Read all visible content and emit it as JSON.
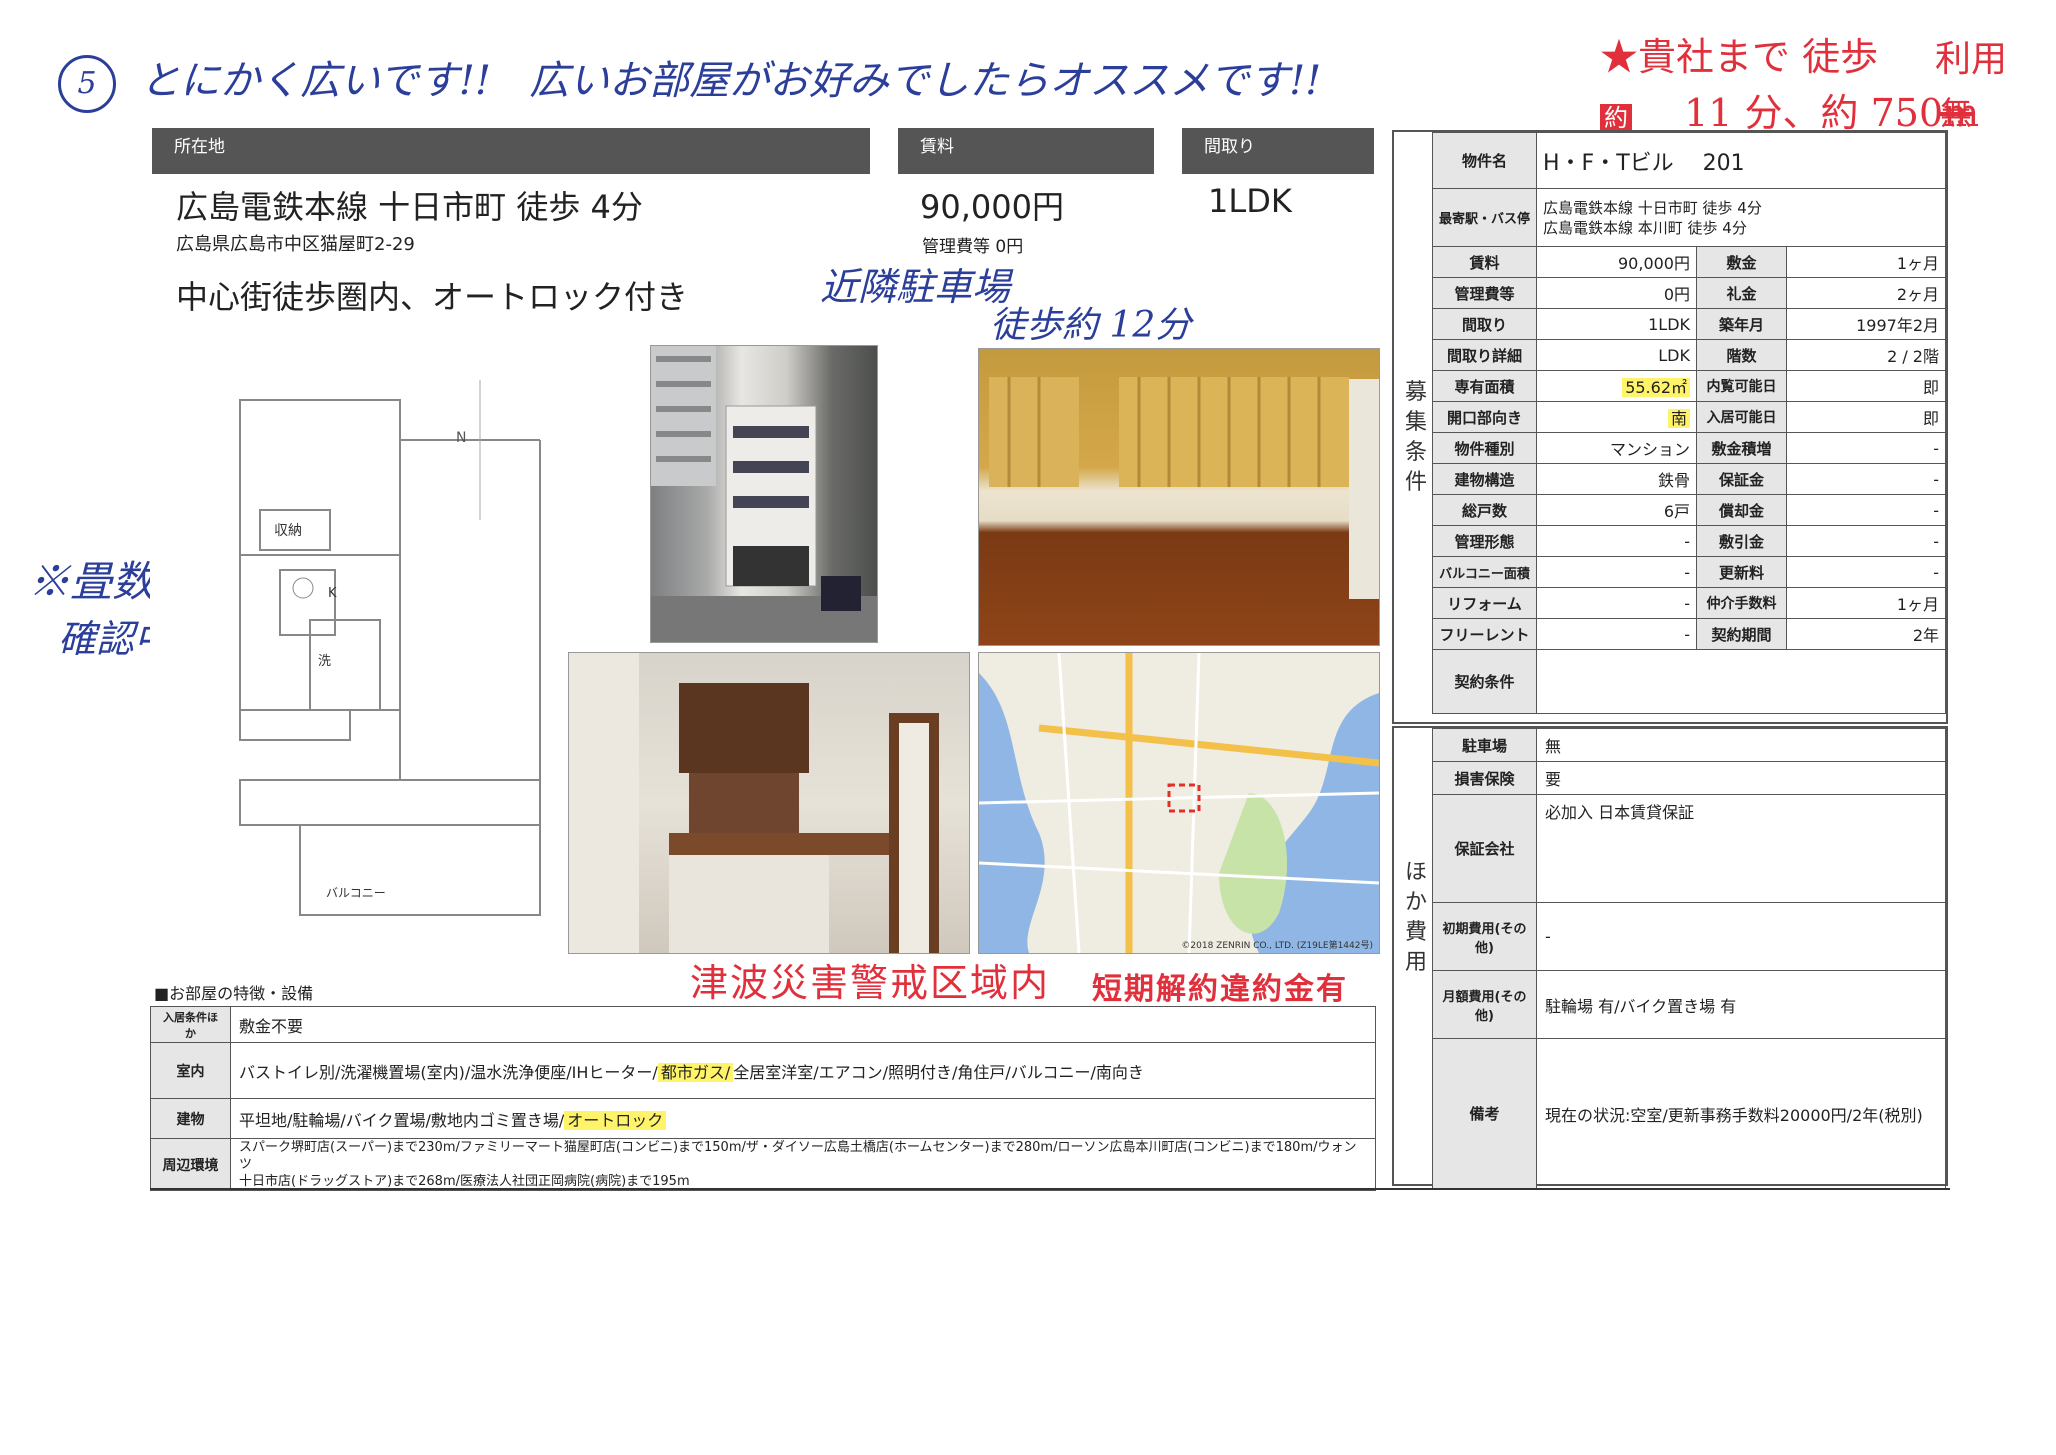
{
  "annotations": {
    "circle_number": "5",
    "top_comment": "とにかく広いです!!   広いお部屋がお好みでしたらオススメです!!",
    "red_line1_star": "★",
    "red_line1": "貴社まで 徒歩",
    "red_riyou": "利用",
    "red_line2_sym": "約",
    "red_line2": "11 分、約 750m",
    "red_crossed": "無",
    "parking_note1": "近隣駐車場",
    "parking_note2": "徒歩約 12分",
    "tatami_note1": "※畳数",
    "tatami_note2": "確認中です。",
    "tsunami_warning": "津波災害警戒区域内",
    "short_term_penalty": "短期解約違約金有"
  },
  "header": {
    "location_label": "所在地",
    "rent_label": "賃料",
    "layout_label": "間取り",
    "station": "広島電鉄本線 十日市町 徒歩 4分",
    "address": "広島県広島市中区猫屋町2-29",
    "rent": "90,000円",
    "mgmt_fee": "管理費等 0円",
    "layout": "1LDK",
    "catch_copy": "中心街徒歩圏内、オートロック付き"
  },
  "floorplan": {
    "north": "N",
    "storage": "収納",
    "kitchen": "K",
    "wash": "洗",
    "balcony": "バルコニー"
  },
  "map": {
    "copyright": "©2018 ZENRIN CO., LTD. (Z19LE第1442号)"
  },
  "spec": {
    "side_label": "募集条件",
    "name_label": "物件名",
    "name_value": "H・F・Tビル　 201",
    "station_label": "最寄駅・バス停",
    "station_line1": "広島電鉄本線 十日市町 徒歩 4分",
    "station_line2": "広島電鉄本線 本川町 徒歩 4分",
    "rows": [
      {
        "l1": "賃料",
        "v1": "90,000円",
        "l2": "敷金",
        "v2": "1ヶ月"
      },
      {
        "l1": "管理費等",
        "v1": "0円",
        "l2": "礼金",
        "v2": "2ヶ月"
      },
      {
        "l1": "間取り",
        "v1": "1LDK",
        "l2": "築年月",
        "v2": "1997年2月"
      },
      {
        "l1": "間取り詳細",
        "v1": "LDK",
        "l2": "階数",
        "v2": "2 / 2階"
      },
      {
        "l1": "専有面積",
        "v1": "55.62㎡",
        "l2": "内覧可能日",
        "v2": "即"
      },
      {
        "l1": "開口部向き",
        "v1": "南",
        "l2": "入居可能日",
        "v2": "即"
      },
      {
        "l1": "物件種別",
        "v1": "マンション",
        "l2": "敷金積増",
        "v2": "-"
      },
      {
        "l1": "建物構造",
        "v1": "鉄骨",
        "l2": "保証金",
        "v2": "-"
      },
      {
        "l1": "総戸数",
        "v1": "6戸",
        "l2": "償却金",
        "v2": "-"
      },
      {
        "l1": "管理形態",
        "v1": "-",
        "l2": "敷引金",
        "v2": "-"
      },
      {
        "l1": "バルコニー面積",
        "v1": "-",
        "l2": "更新料",
        "v2": "-"
      },
      {
        "l1": "リフォーム",
        "v1": "-",
        "l2": "仲介手数料",
        "v2": "1ヶ月"
      },
      {
        "l1": "フリーレント",
        "v1": "-",
        "l2": "契約期間",
        "v2": "2年"
      }
    ],
    "contract_label": "契約条件"
  },
  "other": {
    "side_label": "ほか費用",
    "parking_label": "駐車場",
    "parking_value": "無",
    "insurance_label": "損害保険",
    "insurance_value": "要",
    "guarantor_label": "保証会社",
    "guarantor_value": "必加入 日本賃貸保証",
    "initial_label": "初期費用(その他)",
    "initial_value": "-",
    "monthly_label": "月額費用(その他)",
    "monthly_value": "駐輪場 有/バイク置き場 有",
    "remarks_label": "備考",
    "remarks_value": "現在の状況:空室/更新事務手数料20000円/2年(税別)"
  },
  "features": {
    "title": "■お部屋の特徴・設備",
    "cond_label": "入居条件ほか",
    "cond_value": "敷金不要",
    "room_label": "室内",
    "room_a": "バストイレ別/洗濯機置場(室内)/温水洗浄便座/IHヒーター/",
    "room_hl": "都市ガス/",
    "room_b": "全居室洋室/エアコン/照明付き/角住戸/バルコニー/南向き",
    "bldg_label": "建物",
    "bldg_a": "平坦地/駐輪場/バイク置場/敷地内ゴミ置き場/",
    "bldg_hl": "オートロック",
    "env_label": "周辺環境",
    "env_line1": "スパーク堺町店(スーパー)まで230m/ファミリーマート猫屋町店(コンビニ)まで150m/ザ・ダイソー広島土橋店(ホームセンター)まで280m/ローソン広島本川町店(コンビニ)まで180m/ウォンツ",
    "env_line2": "十日市店(ドラッグストア)まで268m/医療法人社団正岡病院(病院)まで195m"
  }
}
